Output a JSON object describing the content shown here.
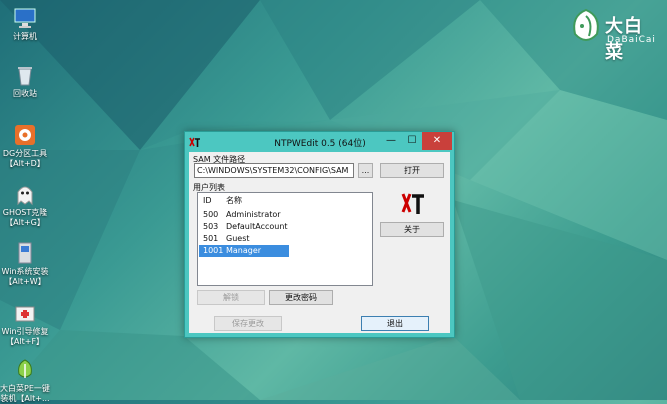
{
  "desktop": {
    "icons": [
      {
        "label1": "计算机",
        "label2": "",
        "icon": "computer-icon"
      },
      {
        "label1": "回收站",
        "label2": "",
        "icon": "recycle-bin-icon"
      },
      {
        "label1": "DG分区工具",
        "label2": "【Alt+D】",
        "icon": "dg-partition-icon"
      },
      {
        "label1": "GHOST克隆",
        "label2": "【Alt+G】",
        "icon": "ghost-icon"
      },
      {
        "label1": "Win系统安装",
        "label2": "【Alt+W】",
        "icon": "win-install-icon"
      },
      {
        "label1": "Win引导修复",
        "label2": "【Alt+F】",
        "icon": "boot-repair-icon"
      },
      {
        "label1": "大白菜PE一键",
        "label2": "装机【Alt+...",
        "icon": "dabaicai-pe-icon"
      }
    ],
    "brand": {
      "cn": "大白菜",
      "en": "DaBaiCai"
    }
  },
  "window": {
    "title": "NTPWEdit 0.5 (64位)",
    "min_glyph": "—",
    "max_glyph": "☐",
    "close_glyph": "✕",
    "sam_label": "SAM 文件路径",
    "sam_path": "C:\\WINDOWS\\SYSTEM32\\CONFIG\\SAM",
    "browse_label": "...",
    "open_label": "打开",
    "users_label": "用户列表",
    "columns": {
      "id": "ID",
      "name": "名称"
    },
    "users": [
      {
        "id": "500",
        "name": "Administrator"
      },
      {
        "id": "503",
        "name": "DefaultAccount"
      },
      {
        "id": "501",
        "name": "Guest"
      },
      {
        "id": "1001",
        "name": "Manager"
      }
    ],
    "selected_index": 3,
    "logo_text": "NT",
    "about_label": "关于",
    "unlock_label": "解锁",
    "change_pwd_label": "更改密码",
    "save_label": "保存更改",
    "exit_label": "退出"
  }
}
